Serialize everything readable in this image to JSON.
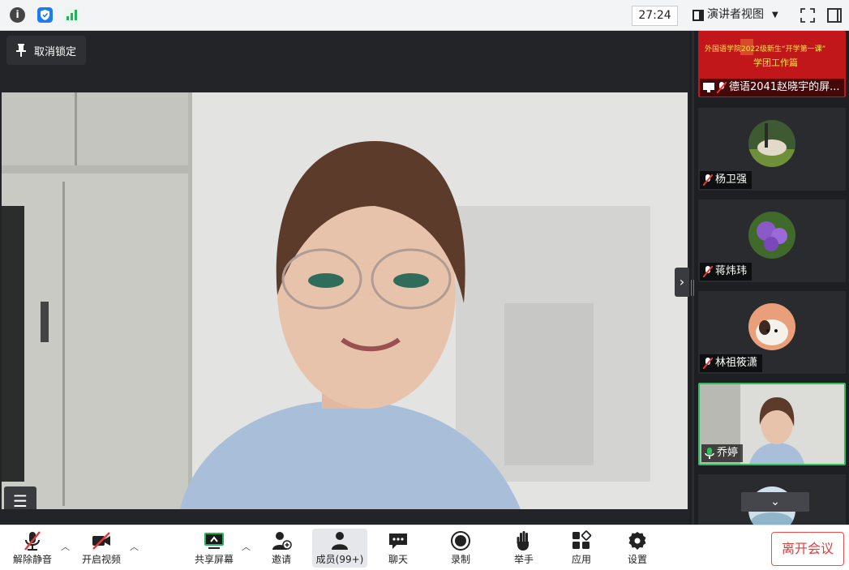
{
  "topbar": {
    "timer": "27:24",
    "view_label": "演讲者视图",
    "accent": "#1e7cf2",
    "signal_color": "#21b35b"
  },
  "stage": {
    "unpin_label": "取消锁定"
  },
  "sidebar": {
    "tiles": [
      {
        "name": "德语2041赵晓宇的屏...",
        "banner_line1": "外国语学院2022级新生“开学第一课”",
        "banner_line2": "学团工作篇",
        "kind": "screen-share"
      },
      {
        "name": "杨卫强",
        "kind": "avatar"
      },
      {
        "name": "蒋炜玮",
        "kind": "avatar"
      },
      {
        "name": "林祖筱潇",
        "kind": "avatar"
      },
      {
        "name": "乔婷",
        "kind": "video",
        "speaking": true
      }
    ]
  },
  "toolbar": {
    "unmute": "解除静音",
    "start_video": "开启视频",
    "share_screen": "共享屏幕",
    "invite": "邀请",
    "members": "成员(99+)",
    "chat": "聊天",
    "record": "录制",
    "raise_hand": "举手",
    "apps": "应用",
    "settings": "设置",
    "leave": "离开会议",
    "danger_color": "#e53a3a",
    "share_color": "#21b35b"
  }
}
